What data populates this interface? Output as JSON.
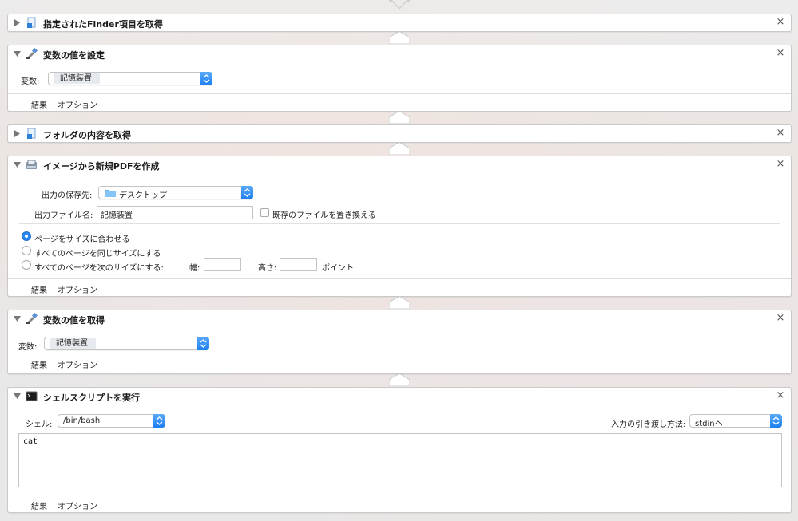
{
  "actions": [
    {
      "title": "指定されたFinder項目を取得",
      "collapsed": true,
      "icon": "finder-file-icon"
    },
    {
      "title": "変数の値を設定",
      "collapsed": false,
      "icon": "set-variable-icon",
      "variable_label": "変数:",
      "variable_value": "記憶装置"
    },
    {
      "title": "フォルダの内容を取得",
      "collapsed": true,
      "icon": "finder-file-icon"
    },
    {
      "title": "イメージから新規PDFを作成",
      "collapsed": false,
      "icon": "pdf-scanner-icon",
      "save_label": "出力の保存先:",
      "save_value": "デスクトップ",
      "filename_label": "出力ファイル名:",
      "filename_value": "記憶装置",
      "replace_label": "既存のファイルを置き換える",
      "radio_fit": "ページをサイズに合わせる",
      "radio_same": "すべてのページを同じサイズにする",
      "radio_next": "すべてのページを次のサイズにする:",
      "width_label": "幅:",
      "height_label": "高さ:",
      "unit_label": "ポイント"
    },
    {
      "title": "変数の値を取得",
      "collapsed": false,
      "icon": "get-variable-icon",
      "variable_label": "変数:",
      "variable_value": "記憶装置"
    },
    {
      "title": "シェルスクリプトを実行",
      "collapsed": false,
      "icon": "terminal-icon",
      "shell_label": "シェル:",
      "shell_value": "/bin/bash",
      "pass_input_label": "入力の引き渡し方法:",
      "pass_input_value": "stdinへ",
      "script_text": "cat"
    }
  ],
  "footer": {
    "results": "結果",
    "options": "オプション"
  },
  "close_glyph": "×",
  "colors": {
    "accent": "#1d7ff0",
    "panel_border": "#c9c9c9"
  }
}
